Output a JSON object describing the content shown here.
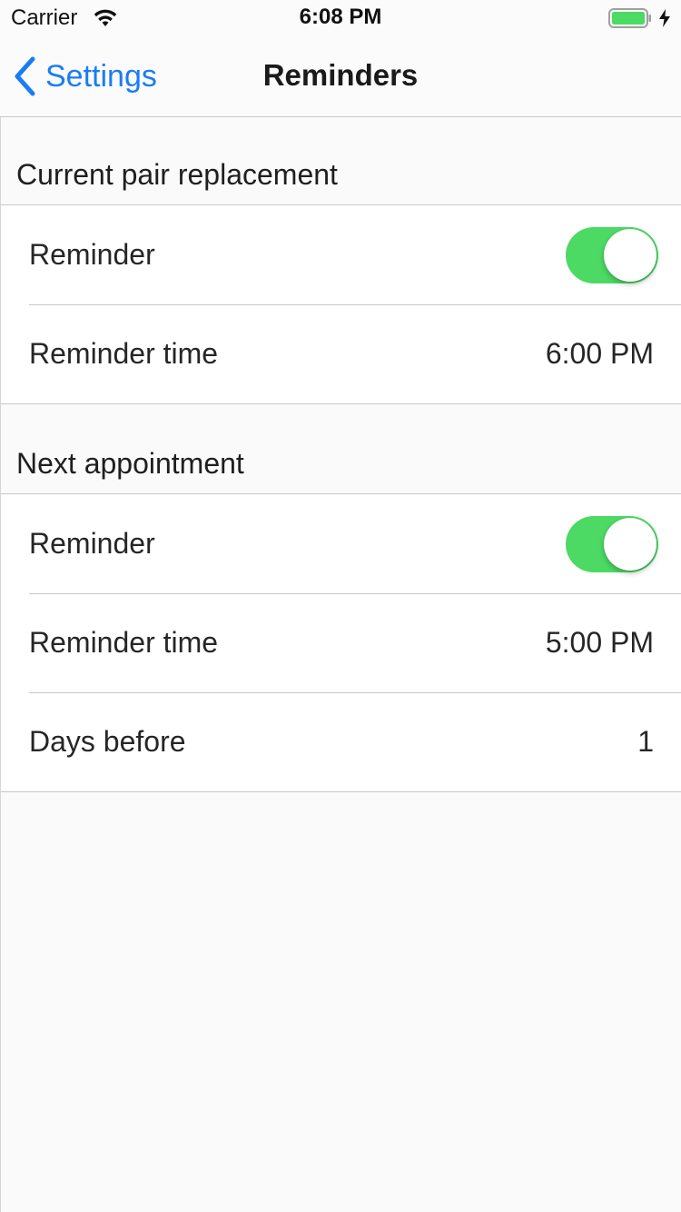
{
  "status_bar": {
    "carrier": "Carrier",
    "time": "6:08 PM",
    "wifi_icon": "wifi-icon",
    "battery_icon": "battery-icon",
    "charging_icon": "charging-bolt-icon"
  },
  "nav": {
    "back_label": "Settings",
    "back_icon": "chevron-left-icon",
    "title": "Reminders"
  },
  "sections": [
    {
      "header": "Current pair replacement",
      "rows": [
        {
          "label": "Reminder",
          "type": "toggle",
          "on": true
        },
        {
          "label": "Reminder time",
          "type": "value",
          "value": "6:00 PM"
        }
      ]
    },
    {
      "header": "Next appointment",
      "rows": [
        {
          "label": "Reminder",
          "type": "toggle",
          "on": true
        },
        {
          "label": "Reminder time",
          "type": "value",
          "value": "5:00 PM"
        },
        {
          "label": "Days before",
          "type": "value",
          "value": "1"
        }
      ]
    }
  ],
  "colors": {
    "accent": "#1a7cf5",
    "toggle_on": "#4cd964",
    "background": "#fafafa",
    "separator": "#c8c8c8"
  }
}
